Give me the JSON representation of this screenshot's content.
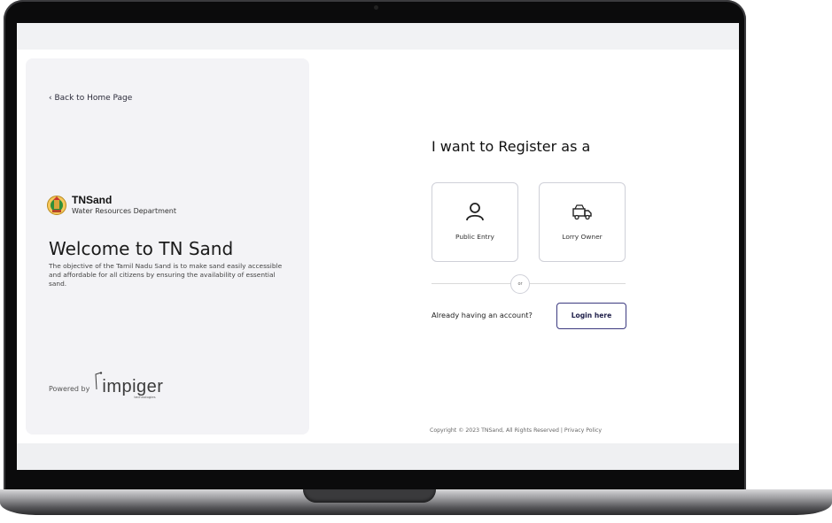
{
  "left": {
    "back_link": "‹ Back to Home Page",
    "brand_name": "TNSand",
    "brand_dept": "Water Resources Department",
    "welcome_title": "Welcome to TN Sand",
    "welcome_desc": "The objective of the Tamil Nadu Sand is to make sand easily accessible and affordable for all citizens by ensuring the availability of essential sand.",
    "powered_by": "Powered by",
    "impiger_word": "impiger",
    "impiger_sub": "technologies"
  },
  "right": {
    "title": "I want to Register as a",
    "options": [
      {
        "label": "Public Entry",
        "icon": "user-icon"
      },
      {
        "label": "Lorry Owner",
        "icon": "lorry-icon"
      }
    ],
    "or_text": "or",
    "already_text": "Already having an account?",
    "login_button": "Login here",
    "copyright": "Copyright © 2023 TNSand, All Rights Reserved | Privacy Policy"
  },
  "colors": {
    "panel_bg": "#f3f3f6",
    "accent": "#3c3a80",
    "border": "#cfd0d8"
  }
}
